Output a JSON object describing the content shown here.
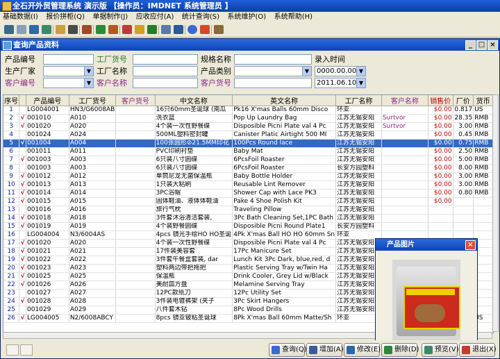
{
  "app": {
    "title": "全石开外贸管理系统 演示版   【操作员：IMDNET   系统管理员 】"
  },
  "menu": [
    "基础数据(I)",
    "报价拼柜(Q)",
    "单据制作(J)",
    "应收应付(A)",
    "统计查询(S)",
    "系统维护(O)",
    "系统帮助(H)"
  ],
  "window": {
    "title": "查询产品资料"
  },
  "filters": {
    "row1": {
      "product_code": "产品编号",
      "factory_code": "工厂货号",
      "spec": "规格名称",
      "entry_time": "录入时间"
    },
    "row2": {
      "factory_from": "生产厂家",
      "factory_name": "工厂名称",
      "category": "产品类别",
      "date_from": "0000.00.00"
    },
    "row3": {
      "customer_code": "客户编号",
      "customer_name": "客户名称",
      "customer_item": "客户货号",
      "date_to": "2011.06.10"
    }
  },
  "columns": [
    "序号",
    "产品编号",
    "工厂货号",
    "客户货号",
    "中文名称",
    "英文名称",
    "工厂名称",
    "客户名称",
    "销售价",
    "厂价",
    "货币"
  ],
  "rows": [
    {
      "n": "1",
      "chk": "",
      "code": "LG004001",
      "fcode": "HN3/G6008AB",
      "ccode": "",
      "cn": "16只60mm圣诞球 (南瓜",
      "en": "Pk16 X'mas Balls 60mm Disco",
      "fac": "环亚",
      "cust": "",
      "price": "$0.00",
      "fp": "0.817",
      "cur": "US"
    },
    {
      "n": "2",
      "chk": "√",
      "code": "001010",
      "fcode": "A010",
      "ccode": "",
      "cn": "洗衣篮",
      "en": "Pop Up Laundry Bag",
      "fac": "江苏无锡安阳",
      "cust": "Surtvor",
      "price": "$0.00",
      "fp": "28.35",
      "cur": "RMB"
    },
    {
      "n": "3",
      "chk": "√",
      "code": "001020",
      "fcode": "A020",
      "ccode": "",
      "cn": "4个装一次性野餐碟",
      "en": "Disposible Picni Plate val 4 Pc",
      "fac": "江苏无锡安阳",
      "cust": "Surtvor",
      "price": "$0.00",
      "fp": "3.00",
      "cur": "RMB"
    },
    {
      "n": "4",
      "chk": "",
      "code": "001024",
      "fcode": "A024",
      "ccode": "",
      "cn": "500ML塑料密封罐",
      "en": "Canister Platic Airtight 500 MI",
      "fac": "江苏无锡安阳",
      "cust": "",
      "price": "$0.00",
      "fp": "0.45",
      "cur": "RMB"
    },
    {
      "n": "5",
      "chk": "√",
      "code": "001004",
      "fcode": "A004",
      "ccode": "",
      "cn": "100张圆形⊘21.5MM印花",
      "en": "100Pcs Round lace",
      "fac": "江苏无锡安阳",
      "cust": "",
      "price": "$0.00",
      "fp": "0.75",
      "cur": "RMB",
      "sel": true
    },
    {
      "n": "6",
      "chk": "",
      "code": "001011",
      "fcode": "A011",
      "ccode": "",
      "cn": "PVC印刷衬垫",
      "en": "Baby Mat",
      "fac": "江苏无锡安阳",
      "cust": "",
      "price": "$0.00",
      "fp": "2.50",
      "cur": "RMB"
    },
    {
      "n": "7",
      "chk": "√",
      "code": "001003",
      "fcode": "A003",
      "ccode": "",
      "cn": "6只装八寸圆碟",
      "en": "6PcsFoil Roaster",
      "fac": "江苏无锡安阳",
      "cust": "",
      "price": "$0.00",
      "fp": "5.00",
      "cur": "RMB"
    },
    {
      "n": "8",
      "chk": "",
      "code": "001003",
      "fcode": "A003",
      "ccode": "",
      "cn": "6只装八寸圆碟",
      "en": "6PcsFoil Roaster",
      "fac": "长安方园塑料",
      "cust": "",
      "price": "$0.00",
      "fp": "8.00",
      "cur": "RMB"
    },
    {
      "n": "9",
      "chk": "√",
      "code": "001012",
      "fcode": "A012",
      "ccode": "",
      "cn": "单筒尼龙无菌保温瓶",
      "en": "Baby Bottle Holder",
      "fac": "江苏无锡安阳",
      "cust": "",
      "price": "$0.00",
      "fp": "3.00",
      "cur": "RMB"
    },
    {
      "n": "10",
      "chk": "√",
      "code": "001013",
      "fcode": "A013",
      "ccode": "",
      "cn": "1只装大粘刷",
      "en": "Reusable Lint Remover",
      "fac": "江苏无锡安阳",
      "cust": "",
      "price": "$0.00",
      "fp": "3.00",
      "cur": "RMB"
    },
    {
      "n": "11",
      "chk": "√",
      "code": "001014",
      "fcode": "A014",
      "ccode": "",
      "cn": "3PC浴帽",
      "en": "Shower Cap with Lace PK3",
      "fac": "江苏无锡安阳",
      "cust": "",
      "price": "$0.00",
      "fp": "0.80",
      "cur": "RMB"
    },
    {
      "n": "12",
      "chk": "√",
      "code": "001015",
      "fcode": "A015",
      "ccode": "",
      "cn": "固体鞋油、液体体鞋油",
      "en": "Pake 4 Shoe Polish Kit",
      "fac": "江苏无锡安阳",
      "cust": "",
      "price": "$0.00",
      "fp": "",
      "cur": ""
    },
    {
      "n": "13",
      "chk": "",
      "code": "001016",
      "fcode": "A016",
      "ccode": "",
      "cn": "旅行气枕",
      "en": "Traveling Pillow",
      "fac": "江苏无锡安阳",
      "cust": "",
      "price": "",
      "fp": "",
      "cur": ""
    },
    {
      "n": "14",
      "chk": "√",
      "code": "001018",
      "fcode": "A018",
      "ccode": "",
      "cn": "3件套沐浴清洁套装,",
      "en": "3Pc Bath Cleaning Set,1PC Bath",
      "fac": "江苏无锡安阳",
      "cust": "",
      "price": "",
      "fp": "",
      "cur": ""
    },
    {
      "n": "15",
      "chk": "√",
      "code": "001019",
      "fcode": "A019",
      "ccode": "",
      "cn": "4个装野餐圆碟",
      "en": "Disposible Picni Round Plate1",
      "fac": "长安方园塑料",
      "cust": "",
      "price": "",
      "fp": "",
      "cur": ""
    },
    {
      "n": "16",
      "chk": "",
      "code": "LG004004",
      "fcode": "N3/6004AS",
      "ccode": "",
      "cn": "4pcs 镜光手绘HO HO圣诞",
      "en": "4Pk X'mas Ball HO HO 60mm Sn",
      "fac": "环亚",
      "cust": "",
      "price": "",
      "fp": "",
      "cur": ""
    },
    {
      "n": "17",
      "chk": "√",
      "code": "001020",
      "fcode": "A020",
      "ccode": "",
      "cn": "4个装一次性野餐碟",
      "en": "Disposible Picni Plate val 4 Pc",
      "fac": "江苏无锡安阳",
      "cust": "",
      "price": "",
      "fp": "",
      "cur": ""
    },
    {
      "n": "18",
      "chk": "√",
      "code": "001021",
      "fcode": "A021",
      "ccode": "",
      "cn": "17件装美容套",
      "en": "17Pc Manicure Set",
      "fac": "江苏无锡安阳",
      "cust": "",
      "price": "",
      "fp": "",
      "cur": ""
    },
    {
      "n": "19",
      "chk": "√",
      "code": "001022",
      "fcode": "A022",
      "ccode": "",
      "cn": "3件套午餐盒套装, dar",
      "en": "Lunch Kit 3Pc Dark, blue,red, d",
      "fac": "江苏无锡安阳",
      "cust": "",
      "price": "",
      "fp": "",
      "cur": ""
    },
    {
      "n": "20",
      "chk": "√",
      "code": "001023",
      "fcode": "A023",
      "ccode": "",
      "cn": "塑料两边带把拖把",
      "en": "Plastic Serving Tray w/Twin Ha",
      "fac": "江苏无锡安阳",
      "cust": "",
      "price": "",
      "fp": "",
      "cur": ""
    },
    {
      "n": "21",
      "chk": "√",
      "code": "001025",
      "fcode": "A025",
      "ccode": "",
      "cn": "保温瓶",
      "en": "Drink Cooler, Grey Lid w/Black",
      "fac": "江苏无锡安阳",
      "cust": "",
      "price": "",
      "fp": "",
      "cur": ""
    },
    {
      "n": "22",
      "chk": "√",
      "code": "001026",
      "fcode": "A026",
      "ccode": "",
      "cn": "美耐皿方盘",
      "en": "Melamine Serving Tray",
      "fac": "江苏无锡安阳",
      "cust": "",
      "price": "",
      "fp": "",
      "cur": ""
    },
    {
      "n": "23",
      "chk": "",
      "code": "001027",
      "fcode": "A027",
      "ccode": "",
      "cn": "12PC款纸刀",
      "en": "12Pc Utility Set",
      "fac": "江苏无锡安阳",
      "cust": "",
      "price": "",
      "fp": "",
      "cur": ""
    },
    {
      "n": "24",
      "chk": "√",
      "code": "001028",
      "fcode": "A028",
      "ccode": "",
      "cn": "3件装电镀裤架 (夹子",
      "en": "3Pc Skirt Hangers",
      "fac": "江苏无锡安阳",
      "cust": "",
      "price": "",
      "fp": "",
      "cur": ""
    },
    {
      "n": "25",
      "chk": "",
      "code": "001029",
      "fcode": "A029",
      "ccode": "",
      "cn": "八件套木钻",
      "en": "8Pc Wood Drills",
      "fac": "江苏无锡安阳",
      "cust": "",
      "price": "",
      "fp": "",
      "cur": ""
    },
    {
      "n": "26",
      "chk": "√",
      "code": "LG004005",
      "fcode": "N2/6008ABCY",
      "ccode": "",
      "cn": "8pcs 镜亚铍粘圣诞球",
      "en": "8Pk X'mas Ball 60mm Matte/Sh",
      "fac": "环亚",
      "cust": "",
      "price": "$0.00",
      "fp": "2.50",
      "cur": "US"
    }
  ],
  "popup": {
    "title": "产品图片"
  },
  "actions": {
    "query": "查询(Q)",
    "add": "增加(A)",
    "edit": "修改(E)",
    "delete": "删除(D)",
    "preview": "预览(V)",
    "exit": "退出(X)"
  },
  "colors": {
    "title_blue": "#0c3ea8",
    "selection": "#316ac5",
    "price_red": "#c00000",
    "customer_purple": "#8a2a8a"
  }
}
